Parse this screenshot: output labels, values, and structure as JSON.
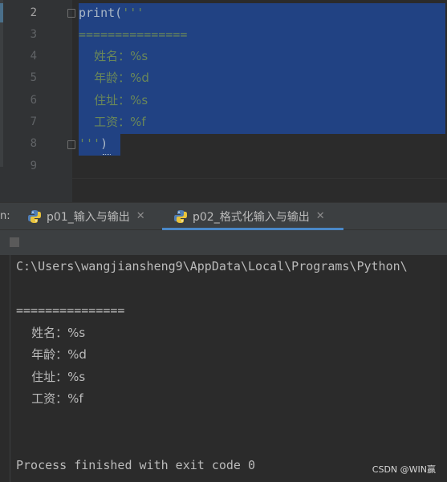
{
  "editor": {
    "line_numbers": [
      "2",
      "3",
      "4",
      "5",
      "6",
      "7",
      "8",
      "9"
    ],
    "code_lines": {
      "l2_fn": "print(",
      "l2_str": "'''",
      "l3": "===============",
      "l4": "    姓名：%s",
      "l5": "    年龄：%d",
      "l6": "    住址：%s",
      "l7": "    工资：%f",
      "l8_str": "'''",
      "l8_paren": ")"
    }
  },
  "tabs": {
    "prefix": "n:",
    "items": [
      {
        "label": "p01_输入与输出",
        "close": "✕"
      },
      {
        "label": "p02_格式化输入与输出",
        "close": "✕"
      }
    ],
    "active_index": 1
  },
  "console": {
    "path_line": "C:\\Users\\wangjiansheng9\\AppData\\Local\\Programs\\Python\\",
    "line_sep": "===============",
    "line_name": "    姓名：%s",
    "line_age": "    年龄：%d",
    "line_addr": "    住址：%s",
    "line_salary": "    工资：%f",
    "exit_line": "Process finished with exit code 0"
  },
  "watermark": "CSDN @WIN赢",
  "colors": {
    "editor_bg": "#2b2b2b",
    "selection": "#214283",
    "string_green": "#6a8759",
    "active_tab_underline": "#4a88c7"
  }
}
